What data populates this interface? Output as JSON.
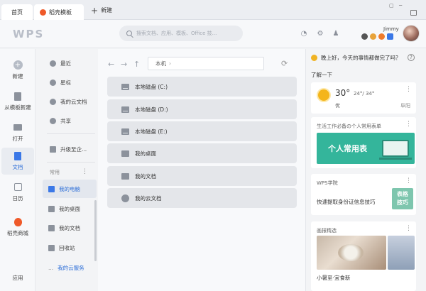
{
  "tabs": {
    "home": "首页",
    "template": "稻壳模板",
    "new": "新建"
  },
  "header": {
    "logo": "WPS",
    "search_placeholder": "搜索文档、应用、模板、Office 技...",
    "username": "Jimmy"
  },
  "rail": {
    "items": [
      {
        "label": "新建",
        "icon": "new-icon"
      },
      {
        "label": "从模板新建",
        "icon": "template-icon"
      },
      {
        "label": "打开",
        "icon": "folder-icon"
      },
      {
        "label": "文档",
        "icon": "document-icon"
      },
      {
        "label": "日历",
        "icon": "calendar-icon"
      },
      {
        "label": "稻壳商城",
        "icon": "store-icon"
      },
      {
        "label": "应用",
        "icon": "apps-icon"
      }
    ],
    "active_color": "#2e6fd8"
  },
  "nav": {
    "items": [
      {
        "label": "最近",
        "icon": "clock-icon"
      },
      {
        "label": "星标",
        "icon": "star-icon"
      },
      {
        "label": "我的云文档",
        "icon": "cloud-icon"
      },
      {
        "label": "共享",
        "icon": "share-icon"
      },
      {
        "label": "升级至企...",
        "icon": "enterprise-icon"
      }
    ],
    "section_title": "常用",
    "common": [
      {
        "label": "我的电脑",
        "icon": "computer-icon"
      },
      {
        "label": "我的桌面",
        "icon": "desktop-icon"
      },
      {
        "label": "我的文档",
        "icon": "documents-icon"
      },
      {
        "label": "回收站",
        "icon": "trash-icon"
      },
      {
        "label": "我的云服务",
        "icon": "cloud-service-icon"
      }
    ]
  },
  "main": {
    "path": "本机",
    "files": [
      {
        "label": "本地磁盘 (C:)",
        "icon": "drive-icon"
      },
      {
        "label": "本地磁盘 (D:)",
        "icon": "drive-icon"
      },
      {
        "label": "本地磁盘 (E:)",
        "icon": "drive-icon"
      },
      {
        "label": "我的桌面",
        "icon": "desktop-icon"
      },
      {
        "label": "我的文档",
        "icon": "folder-icon"
      },
      {
        "label": "我的云文档",
        "icon": "cloud-icon"
      }
    ]
  },
  "right": {
    "greeting": "晚上好，今天的事情都做完了吗？",
    "learn": "了解一下",
    "weather": {
      "temp": "30°",
      "range": "24°/ 34°",
      "quality": "优",
      "city": "阜阳"
    },
    "table_card": {
      "title": "生活工作必备の个人常用表单",
      "banner": "个人常用表"
    },
    "academy": {
      "title": "WPS学院",
      "text": "快速提取身份证信息技巧",
      "tag_line1": "表格",
      "tag_line2": "技巧"
    },
    "gallery": {
      "title": "画报精选",
      "caption": "小暑至·宜食新"
    }
  }
}
